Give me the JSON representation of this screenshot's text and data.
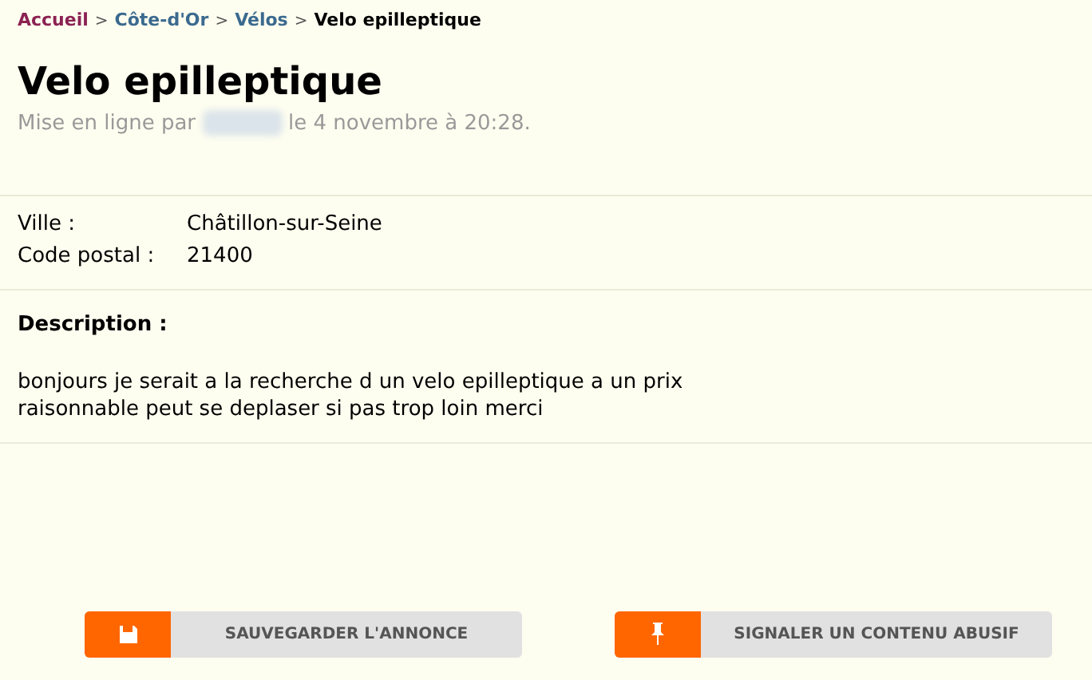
{
  "breadcrumb": [
    {
      "label": "Accueil",
      "color": "#8b2252"
    },
    {
      "label": "Côte-d'Or",
      "color": "#3b6a8f"
    },
    {
      "label": "Vélos",
      "color": "#3b6a8f"
    },
    {
      "label": "Velo epilleptique",
      "color": "#000000"
    }
  ],
  "breadcrumb_separator": ">",
  "title": "Velo epilleptique",
  "posted": {
    "before": "Mise en ligne par",
    "after": "le 4 novembre à 20:28."
  },
  "details": [
    {
      "label": "Ville :",
      "value": "Châtillon-sur-Seine"
    },
    {
      "label": "Code postal :",
      "value": "21400"
    }
  ],
  "description": {
    "heading": "Description :",
    "lines": [
      "bonjours je serait a la recherche d un velo epilleptique a un prix",
      "raisonnable peut se deplaser si pas trop loin merci"
    ]
  },
  "buttons": [
    {
      "label": "SAUVEGARDER L'ANNONCE",
      "kind": "save"
    },
    {
      "label": "SIGNALER UN CONTENU ABUSIF",
      "kind": "report"
    }
  ]
}
